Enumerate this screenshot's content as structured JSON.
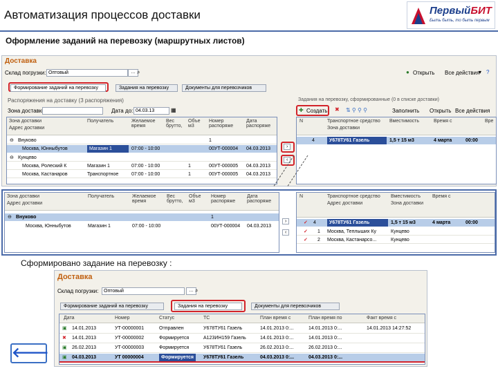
{
  "header": {
    "title": "Автоматизация процессов доставки",
    "logo_name_a": "Первый",
    "logo_name_b": "БИТ",
    "logo_tagline": "Быть быть, то быть первым",
    "subtitle": "Оформление заданий на перевозку (маршрутных листов)"
  },
  "top": {
    "window_title": "Доставка",
    "warehouse_label": "Склад погрузки:",
    "warehouse_value": "Оптовый",
    "btn_open": "Открыть",
    "btn_more": "Все действия",
    "tabs": [
      "Формирование заданий на перевозку",
      "Задания на перевозку",
      "Документы для перевозчиков"
    ],
    "left_title": "Распоряжения на доставку (3 распоряжения)",
    "zone_label": "Зона доставки:",
    "date_label": "Дата до:",
    "date_value": "04.03.13",
    "cols": [
      "Зона доставки",
      "Получатель",
      "Желаемое время",
      "Вес брутто,",
      "Объе м3",
      "Номер распоряже",
      "Дата распоряже"
    ],
    "cols2": [
      "Адрес доставки"
    ],
    "groups": [
      {
        "zone": "Внуково",
        "rows": [
          {
            "addr": "Москва, Юнныбутов",
            "rec": "Магазин 1",
            "time": "07:00 - 10:00",
            "weight": "",
            "vol": "1",
            "num": "00УТ-000004",
            "date": "04.03.2013"
          }
        ]
      },
      {
        "zone": "Кунцево",
        "rows": [
          {
            "addr": "Москва, Ролеский К",
            "rec": "Магазин 1",
            "time": "07:00 - 10:00",
            "weight": "",
            "vol": "1",
            "num": "00УТ-000005",
            "date": "04.03.2013"
          },
          {
            "addr": "Москва, Кастанаров",
            "rec": "Транспортное",
            "time": "07:00 - 10:00",
            "weight": "",
            "vol": "1",
            "num": "00УТ-000005",
            "date": "04.03.2013"
          }
        ]
      }
    ],
    "right_title": "Задания на перевозку, сформированные (0 в списке доставки)",
    "btn_create": "Создать",
    "btn_fill": "Заполнить",
    "btn_open2": "Открыть",
    "btn_more2": "Все действия",
    "rcols": [
      "N",
      "Транспортное средство",
      "Вместимость",
      "Время с",
      "Вре"
    ],
    "rcols2": [
      "Зона доставки"
    ],
    "rrow": {
      "n": "4",
      "vehicle": "У678ТУ61 Газель",
      "cap": "1,5 т 15 м3",
      "from": "4 марта",
      "to": "00:00"
    }
  },
  "middle": {
    "cols": [
      "Зона доставки",
      "Получатель",
      "Желаемое время",
      "Вес брутто,",
      "Объе м3",
      "Номер распоряже",
      "Дата распоряже"
    ],
    "cols2": [
      "Адрес доставки"
    ],
    "zone": "Внуково",
    "row": {
      "addr": "Москва, Юнныбутов",
      "rec": "Магазин 1",
      "time": "07:00 - 10:00",
      "weight": "",
      "vol": "1",
      "num": "00УТ-000004",
      "date": "04.03.2013"
    },
    "rcols": [
      "N",
      "Транспортное средство",
      "Вместимость",
      "Время с"
    ],
    "rcols2": [
      "Адрес доставки",
      "Зона доставки"
    ],
    "rrows": [
      {
        "n": "4",
        "vehicle": "У678ТУ61 Газель",
        "cap": "1,5 т 15 м3",
        "from": "4 марта",
        "to": "00:00",
        "sel": true
      },
      {
        "n": "1",
        "vehicle": "Москва, Теплыших Ку",
        "cap": "Кунцево",
        "from": "",
        "to": "",
        "sel": false
      },
      {
        "n": "2",
        "vehicle": "Москва, Кастанарсо...",
        "cap": "Кунцево",
        "from": "",
        "to": "",
        "sel": false
      }
    ]
  },
  "caption": "Сформировано задание на перевозку :",
  "bottom": {
    "window_title": "Доставка",
    "warehouse_label": "Склад погрузки:",
    "warehouse_value": "Оптовый",
    "tabs": [
      "Формирование заданий на перевозку",
      "Задания на перевозку",
      "Документы для перевозчиков"
    ],
    "cols": [
      "Дата",
      "Номер",
      "Статус",
      "ТС",
      "План время с",
      "План время по",
      "Факт время с"
    ],
    "rows": [
      {
        "date": "14.01.2013",
        "num": "УТ-00000001",
        "status": "Отправлен",
        "ts": "У678ТУ61 Газель",
        "p1": "14.01.2013 0:...",
        "p2": "14.01.2013 0:...",
        "f1": "14.01.2013 14:27:52",
        "sel": false
      },
      {
        "date": "14.01.2013",
        "num": "УТ-00000002",
        "status": "Формируется",
        "ts": "А123ИН159 Газель",
        "p1": "14.01.2013 0:...",
        "p2": "14.01.2013 0:...",
        "f1": "",
        "sel": false
      },
      {
        "date": "26.02.2013",
        "num": "УТ-00000003",
        "status": "Формируется",
        "ts": "У678ТУ61 Газель",
        "p1": "26.02.2013 0:...",
        "p2": "26.02.2013 0:...",
        "f1": "",
        "sel": false
      },
      {
        "date": "04.03.2013",
        "num": "УТ 00000004",
        "status": "Формируется",
        "ts": "У678ТУ61 Газель",
        "p1": "04.03.2013 0:...",
        "p2": "04.03.2013 0:...",
        "f1": "",
        "sel": true
      }
    ]
  },
  "back_icon": "arrow-left-icon"
}
